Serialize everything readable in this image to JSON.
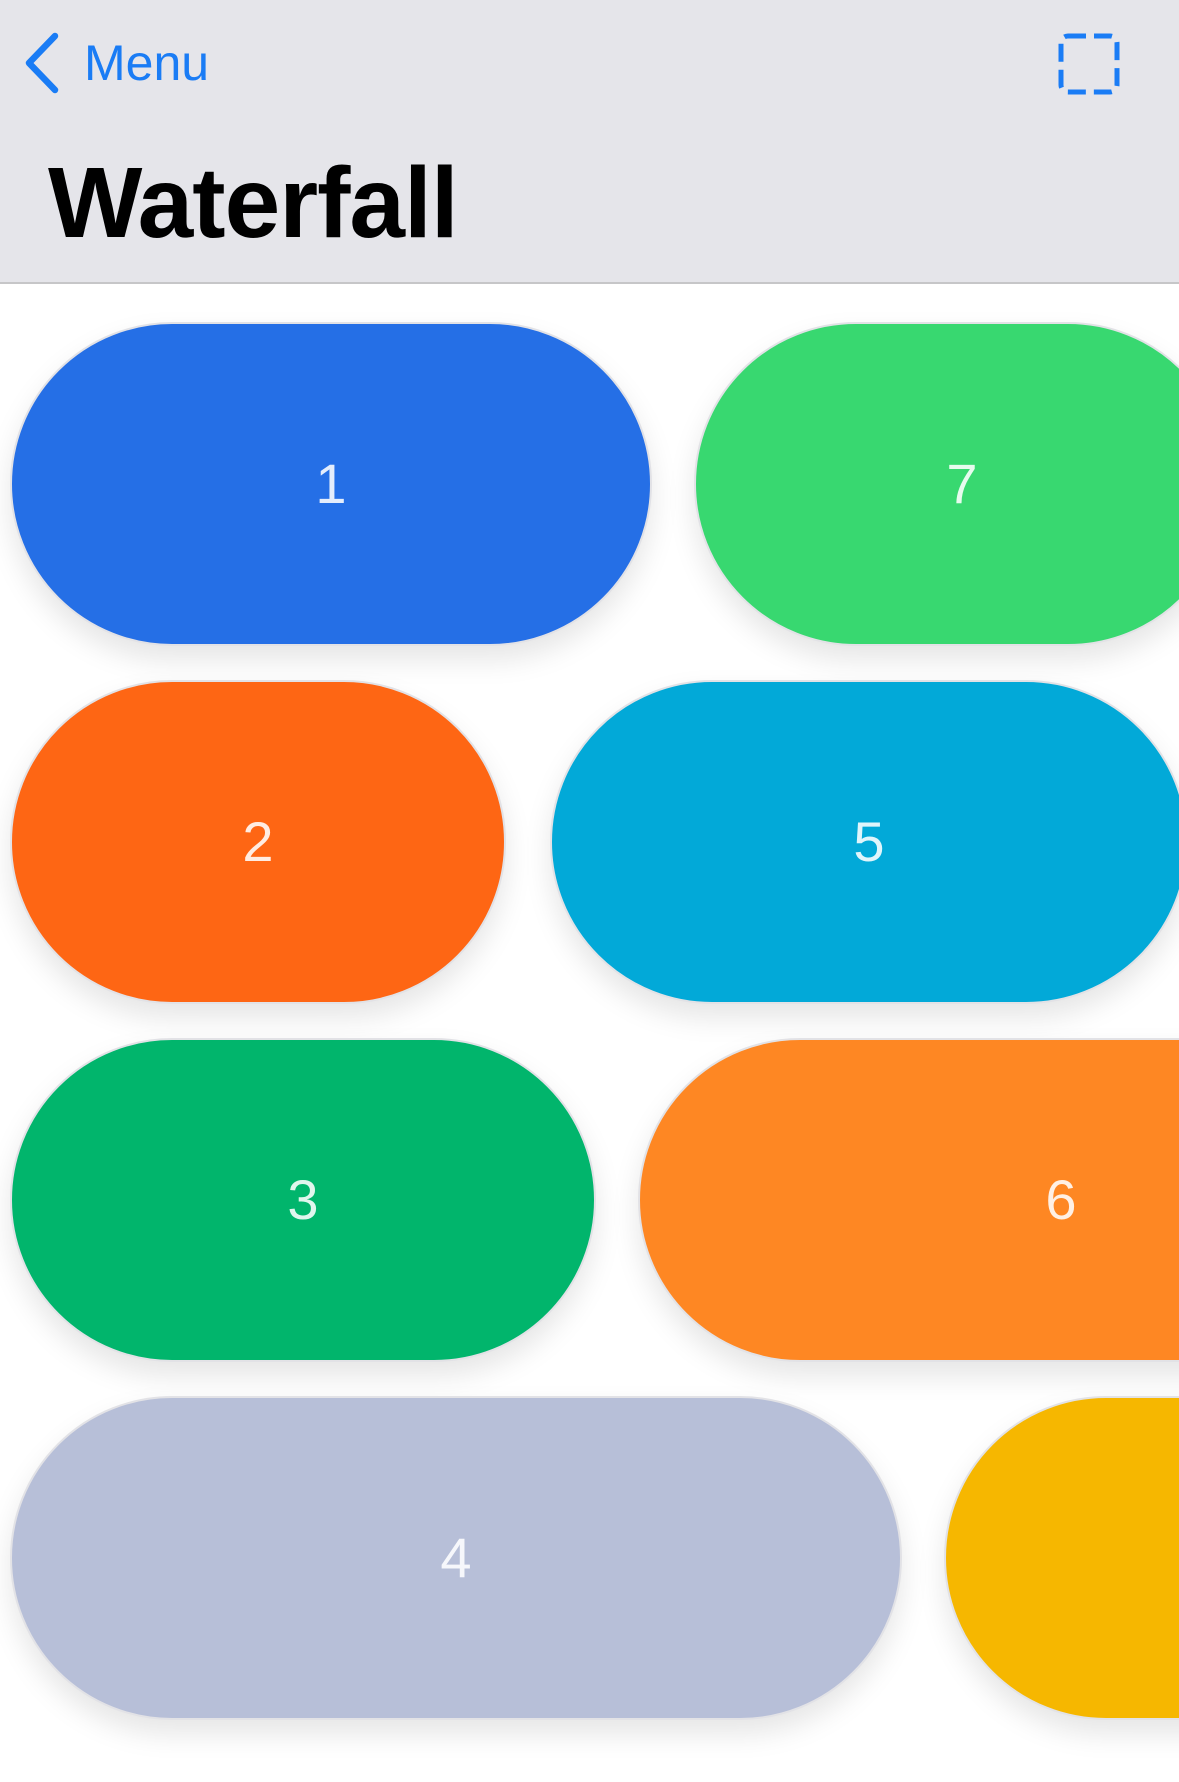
{
  "nav": {
    "back_label": "Menu",
    "title": "Waterfall",
    "accent_color": "#1a7cf5",
    "back_icon": "chevron-left-icon",
    "action_icon": "dashed-selection-icon"
  },
  "tiles": [
    {
      "label": "1",
      "color": "#256fe6"
    },
    {
      "label": "7",
      "color": "#38d870"
    },
    {
      "label": "2",
      "color": "#fe6614"
    },
    {
      "label": "5",
      "color": "#02a9d8"
    },
    {
      "label": "3",
      "color": "#01b56c"
    },
    {
      "label": "6",
      "color": "#fe8723"
    },
    {
      "label": "4",
      "color": "#b7bfd8"
    },
    {
      "label": "",
      "color": "#f6b700"
    }
  ]
}
